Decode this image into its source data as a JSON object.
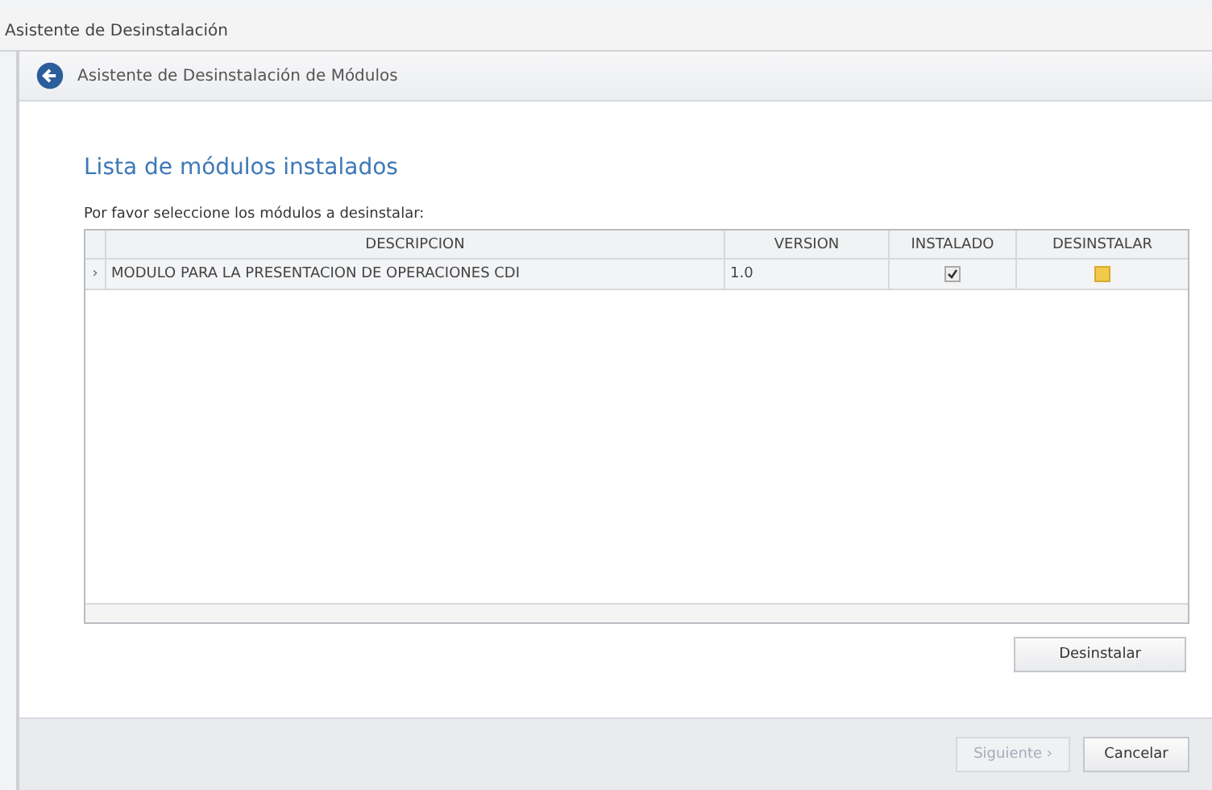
{
  "window": {
    "title": "Asistente de Desinstalación"
  },
  "header": {
    "title": "Asistente de Desinstalación de Módulos"
  },
  "page": {
    "heading": "Lista de módulos instalados",
    "instruction": "Por favor seleccione los módulos a desinstalar:"
  },
  "table": {
    "columns": [
      "DESCRIPCION",
      "VERSION",
      "INSTALADO",
      "DESINSTALAR"
    ],
    "rows": [
      {
        "indicator": "›",
        "description": "MODULO PARA LA PRESENTACION DE OPERACIONES CDI",
        "version": "1.0",
        "installed": true,
        "uninstall": false
      }
    ]
  },
  "uninstall_button": {
    "label": "Desinstalar"
  },
  "footer": {
    "buttons": [
      {
        "label": "Siguiente ›",
        "disabled": true
      },
      {
        "label": "Cancelar",
        "disabled": false
      }
    ]
  }
}
